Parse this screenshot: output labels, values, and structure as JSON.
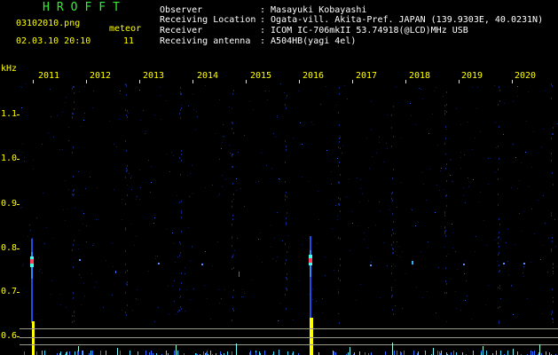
{
  "app_title": "HROFFT",
  "file_name": "03102010.png",
  "datetime": "02.03.10 20:10",
  "meteor_label": "meteor",
  "meteor_count": "11",
  "info_labels": {
    "observer": "Observer",
    "location": "Receiving Location",
    "receiver": "Receiver",
    "antenna": "Receiving antenna"
  },
  "info_values": {
    "observer": ": Masayuki Kobayashi",
    "location": ": Ogata-vill. Akita-Pref. JAPAN (139.9303E, 40.0231N)",
    "receiver": ": ICOM IC-706mkII 53.74918(@LCD)MHz USB",
    "antenna": ": A504HB(yagi 4el)"
  },
  "y_unit": "kHz",
  "x_ticks": [
    "2011",
    "2012",
    "2013",
    "2014",
    "2015",
    "2016",
    "2017",
    "2018",
    "2019",
    "2020"
  ],
  "y_ticks": [
    "1.1",
    "1.0",
    "0.9",
    "0.8",
    "0.7",
    "0.6"
  ],
  "colors": {
    "text_yellow": "#ffff00",
    "title_green": "#33ee33",
    "background": "#000000",
    "signal_blue": "#2a6cff",
    "signal_cyan": "#33ffff",
    "signal_peak": "#ff4060"
  }
}
